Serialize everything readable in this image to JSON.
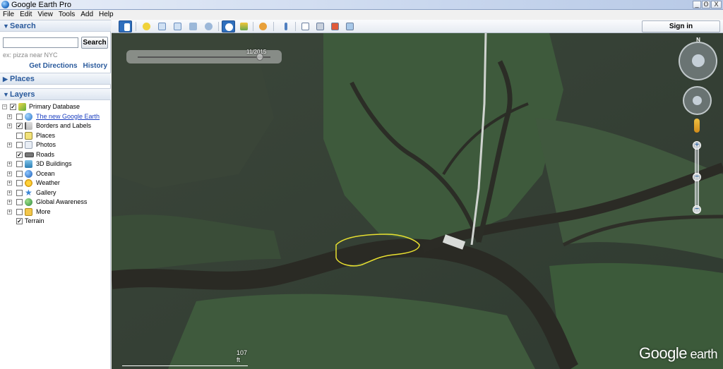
{
  "window": {
    "title": "Google Earth Pro",
    "buttons": [
      "_",
      "ʘ",
      "X"
    ]
  },
  "menu": [
    "File",
    "Edit",
    "View",
    "Tools",
    "Add",
    "Help"
  ],
  "search": {
    "header": "Search",
    "input_value": "",
    "button": "Search",
    "hint": "ex: pizza near NYC",
    "links": [
      "Get Directions",
      "History"
    ]
  },
  "places": {
    "header": "Places"
  },
  "layers": {
    "header": "Layers",
    "items": [
      {
        "label": "Primary Database",
        "checked": true,
        "expander": "−",
        "link": false,
        "icon": "layers-icon"
      },
      {
        "label": "The new Google Earth",
        "checked": false,
        "expander": "+",
        "link": true,
        "icon": "globe-icon"
      },
      {
        "label": "Borders and Labels",
        "checked": true,
        "expander": "+",
        "link": false,
        "icon": "flag-icon"
      },
      {
        "label": "Places",
        "checked": false,
        "expander": "",
        "link": false,
        "icon": "places-icon"
      },
      {
        "label": "Photos",
        "checked": false,
        "expander": "+",
        "link": false,
        "icon": "photos-icon"
      },
      {
        "label": "Roads",
        "checked": true,
        "expander": "",
        "link": false,
        "icon": "roads-icon"
      },
      {
        "label": "3D Buildings",
        "checked": false,
        "expander": "+",
        "link": false,
        "icon": "buildings-icon"
      },
      {
        "label": "Ocean",
        "checked": false,
        "expander": "+",
        "link": false,
        "icon": "ocean-icon"
      },
      {
        "label": "Weather",
        "checked": false,
        "expander": "+",
        "link": false,
        "icon": "weather-icon"
      },
      {
        "label": "Gallery",
        "checked": false,
        "expander": "+",
        "link": false,
        "icon": "gallery-icon"
      },
      {
        "label": "Global Awareness",
        "checked": false,
        "expander": "+",
        "link": false,
        "icon": "global-awareness-icon"
      },
      {
        "label": "More",
        "checked": false,
        "expander": "+",
        "link": false,
        "icon": "more-icon"
      },
      {
        "label": "Terrain",
        "checked": true,
        "expander": "",
        "link": false,
        "icon": ""
      }
    ]
  },
  "toolbar": {
    "sign_in": "Sign in"
  },
  "map": {
    "time_slider_date": "11/2015",
    "scale_label": "107 ft",
    "logo_primary": "Google",
    "logo_secondary": " earth",
    "compass_label": "N"
  },
  "colors": {
    "accent": "#2a5a9c",
    "link": "#1a3ec0",
    "polygon": "#e8e030"
  }
}
